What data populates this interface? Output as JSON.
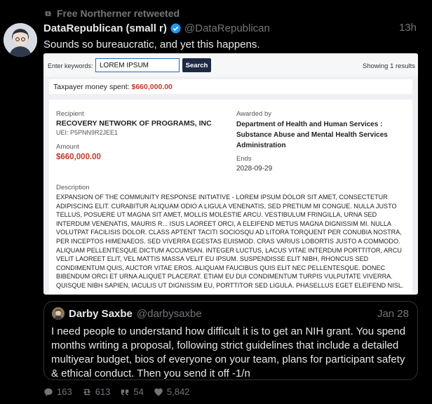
{
  "retweet": {
    "text": "Free Northerner retweeted"
  },
  "tweet": {
    "display_name": "DataRepublican (small r)",
    "handle": "@DataRepublican",
    "time": "13h",
    "text": "Sounds so bureaucratic, and yet this happens."
  },
  "screenshot": {
    "search": {
      "label": "Enter keywords:",
      "value": "LOREM IPSUM",
      "button": "Search",
      "results": "Showing 1 results"
    },
    "spent": {
      "label": "Taxpayer money spent:",
      "amount": "$660,000.00"
    },
    "recipient": {
      "label": "Recipient",
      "name": "RECOVERY NETWORK OF PROGRAMS, INC",
      "uei": "UEI: P5PNN9R2JEE1",
      "amount_label": "Amount",
      "amount": "$660,000.00"
    },
    "awarded": {
      "label": "Awarded by",
      "agency": "Department of Health and Human Services : Substance Abuse and Mental Health Services Administration",
      "ends_label": "Ends",
      "ends": "2028-09-29"
    },
    "description": {
      "label": "Description",
      "text": "Expansion of the community response initiative - Lorem ipsum dolor sit amet, consectetur adipiscing elit. Curabitur aliquam odio a ligula venenatis, sed pretium mi congue. Nulla justo tellus, posuere ut magna sit amet, mollis molestie arcu. Vestibulum fringilla, urna sed interdum venenatis, mauris r... isus laoreet orci, a eleifend metus magna dignissim mi. Nulla volutpat facilisis dolor. Class aptent taciti sociosqu ad litora torquent per conubia nostra, per inceptos himenaeos. Sed viverra egestas euismod. Cras varius lobortis justo a commodo. Aliquam pellentesque dictum accumsan. Integer luctus, lacus vitae interdum porttitor, arcu velit laoreet elit, vel mattis massa velit eu ipsum. Suspendisse elit nibh, rhoncus sed condimentum quis, auctor vitae eros. Aliquam faucibus quis elit nec pellentesque. Donec bibendum orci et urna aliquet placerat. Etiam eu dui condimentum turpis vulputate viverra. Quisque nibh sapien, iaculis ut dignissim eu, porttitor sed ligula. Phasellus eget eleifend nisl."
    }
  },
  "quote": {
    "display_name": "Darby Saxbe",
    "handle": "@darbysaxbe",
    "time": "Jan 28",
    "text": "I need people to understand how difficult it is to get an NIH grant. You spend months writing a proposal, following strict guidelines that include a detailed multiyear budget, bios of everyone on your team, plans for participant safety & ethical conduct. Then you send it off -1/n"
  },
  "actions": {
    "replies": "163",
    "retweets": "613",
    "quotes": "54",
    "likes": "5,842"
  },
  "icons": {
    "retweet": "retweet-icon",
    "verified": "verified-badge-icon",
    "reply": "reply-icon",
    "quote": "quote-icon",
    "like": "heart-icon"
  },
  "colors": {
    "background": "#000000",
    "muted": "#71767b",
    "verified": "#1d9bf0",
    "money": "#c0392b"
  }
}
